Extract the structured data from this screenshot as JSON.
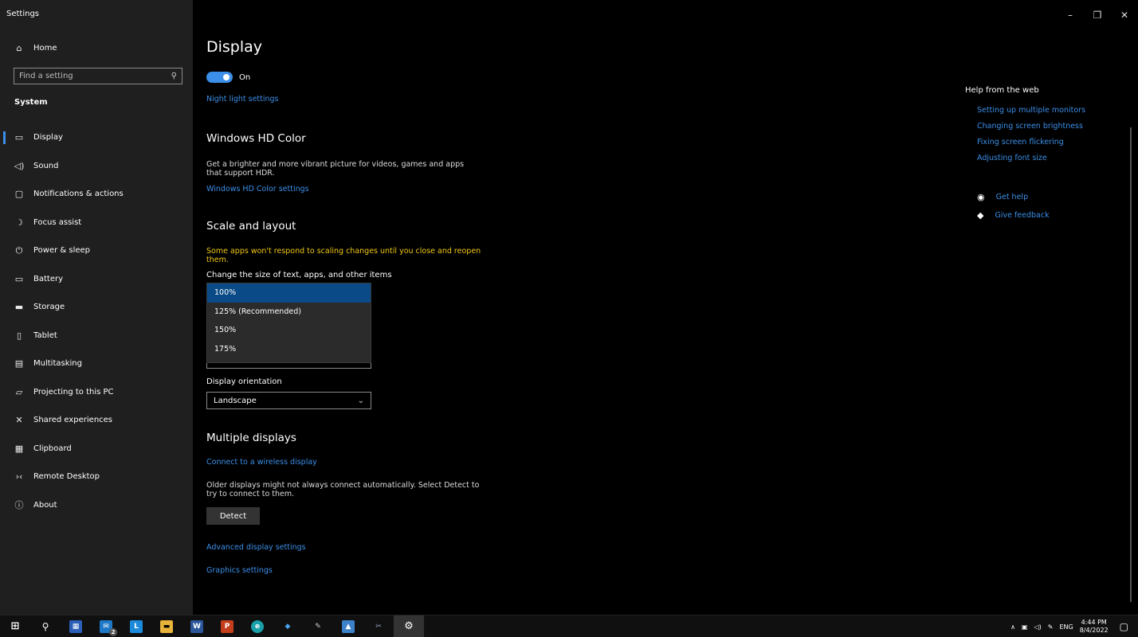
{
  "window": {
    "title": "Settings",
    "controls": {
      "minimize": "–",
      "restore": "❐",
      "close": "✕"
    }
  },
  "sidebar": {
    "home_label": "Home",
    "search_placeholder": "Find a setting",
    "section_label": "System",
    "items": [
      {
        "label": "Display",
        "icon": "monitor-icon"
      },
      {
        "label": "Sound",
        "icon": "speaker-icon"
      },
      {
        "label": "Notifications & actions",
        "icon": "notification-icon"
      },
      {
        "label": "Focus assist",
        "icon": "moon-icon"
      },
      {
        "label": "Power & sleep",
        "icon": "power-icon"
      },
      {
        "label": "Battery",
        "icon": "battery-icon"
      },
      {
        "label": "Storage",
        "icon": "storage-icon"
      },
      {
        "label": "Tablet",
        "icon": "tablet-icon"
      },
      {
        "label": "Multitasking",
        "icon": "multitasking-icon"
      },
      {
        "label": "Projecting to this PC",
        "icon": "projector-icon"
      },
      {
        "label": "Shared experiences",
        "icon": "shared-icon"
      },
      {
        "label": "Clipboard",
        "icon": "clipboard-icon"
      },
      {
        "label": "Remote Desktop",
        "icon": "remote-desktop-icon"
      },
      {
        "label": "About",
        "icon": "info-icon"
      }
    ]
  },
  "main": {
    "title": "Display",
    "night_light": {
      "toggle_label": "On",
      "settings_link": "Night light settings"
    },
    "hd_color": {
      "heading": "Windows HD Color",
      "description": "Get a brighter and more vibrant picture for videos, games and apps that support HDR.",
      "settings_link": "Windows HD Color settings"
    },
    "scale": {
      "heading": "Scale and layout",
      "warning": "Some apps won't respond to scaling changes until you close and reopen them.",
      "size_label": "Change the size of text, apps, and other items",
      "options": [
        "100%",
        "125% (Recommended)",
        "150%",
        "175%"
      ],
      "orientation_label": "Display orientation",
      "orientation_value": "Landscape"
    },
    "multiple": {
      "heading": "Multiple displays",
      "wireless_link": "Connect to a wireless display",
      "description": "Older displays might not always connect automatically. Select Detect to try to connect to them.",
      "detect_button": "Detect",
      "advanced_link": "Advanced display settings",
      "graphics_link": "Graphics settings"
    }
  },
  "help": {
    "title": "Help from the web",
    "links": [
      "Setting up multiple monitors",
      "Changing screen brightness",
      "Fixing screen flickering",
      "Adjusting font size"
    ],
    "get_help": "Get help",
    "give_feedback": "Give feedback"
  },
  "taskbar": {
    "tray": {
      "language": "ENG",
      "time": "4:44 PM",
      "date": "8/4/2022"
    },
    "badge_count": "2"
  }
}
